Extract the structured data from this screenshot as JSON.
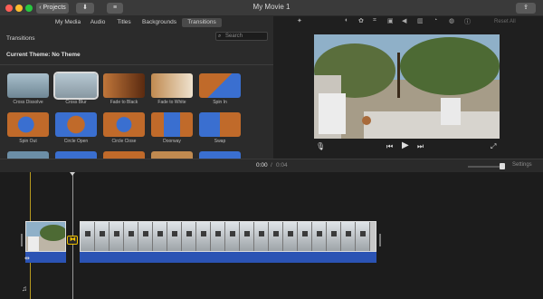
{
  "window": {
    "title": "My Movie 1",
    "projects_label": "Projects",
    "traffic": [
      "#ff5f57",
      "#febc2e",
      "#28c840"
    ]
  },
  "tabs": [
    "My Media",
    "Audio",
    "Titles",
    "Backgrounds",
    "Transitions"
  ],
  "active_tab": "Transitions",
  "browser": {
    "section_title": "Transitions",
    "search_placeholder": "Search",
    "theme_label": "Current Theme: No Theme",
    "transitions": [
      "Cross Dissolve",
      "Cross Blur",
      "Fade to Black",
      "Fade to White",
      "Spin In",
      "Spin Out",
      "Circle Open",
      "Circle Close",
      "Doorway",
      "Swap"
    ],
    "selected": "Cross Blur"
  },
  "viewer": {
    "toolbar_icons": [
      "magic-wand-icon",
      "color-balance-icon",
      "color-correction-icon",
      "crop-icon",
      "stabilization-icon",
      "volume-icon",
      "noise-reduction-icon",
      "speed-icon",
      "clip-filter-icon",
      "info-icon"
    ],
    "reset_all": "Reset All"
  },
  "timebar": {
    "current": "0:00",
    "separator": "/",
    "total": "0:04",
    "settings": "Settings"
  },
  "colors": {
    "accent": "#f0c000",
    "audio": "#2b53b4",
    "selection": "#d9d9d9"
  }
}
